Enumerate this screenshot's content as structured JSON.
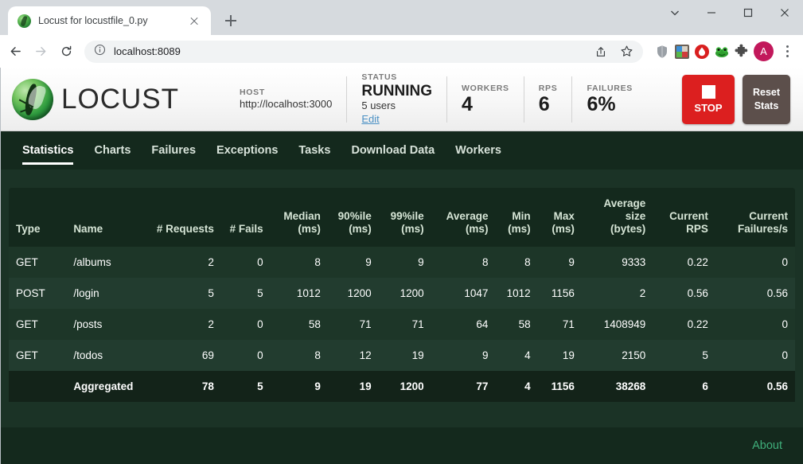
{
  "browser": {
    "tab": {
      "title": "Locust for locustfile_0.py",
      "favicon": "locust-icon",
      "close": "close-icon"
    },
    "new_tab": "new-tab-icon",
    "window_controls": [
      "tab-search-chevron-down",
      "minimize",
      "maximize",
      "close"
    ],
    "nav": {
      "back": "back-arrow-icon",
      "forward": "forward-arrow-icon",
      "reload": "reload-icon"
    },
    "omnibox": {
      "info_icon": "site-info-icon",
      "url": "localhost:8089",
      "share": "share-icon",
      "bookmark": "star-icon"
    },
    "extensions": [
      "shield-icon",
      "colorful-extension-icon",
      "adblock-icon",
      "frog-extension-icon",
      "puzzle-piece-icon"
    ],
    "avatar_letter": "A",
    "menu": "kebab-menu-icon"
  },
  "app": {
    "brand": "LOCUST",
    "stats": [
      {
        "label": "HOST",
        "value": "http://localhost:3000",
        "type": "text"
      },
      {
        "label": "STATUS",
        "value": "RUNNING",
        "sub": "5 users",
        "link": "Edit",
        "type": "status"
      },
      {
        "label": "WORKERS",
        "value": "4",
        "type": "big"
      },
      {
        "label": "RPS",
        "value": "6",
        "type": "big"
      },
      {
        "label": "FAILURES",
        "value": "6%",
        "type": "big"
      }
    ],
    "buttons": {
      "stop": "STOP",
      "reset": "Reset\nStats",
      "reset_line1": "Reset",
      "reset_line2": "Stats"
    },
    "colors": {
      "stop": "#dc1f1f",
      "reset": "#5c4f4b",
      "nav_bg": "#14291d",
      "page_bg": "#1b3326",
      "link": "#3fae7a"
    },
    "nav_tabs": [
      {
        "label": "Statistics",
        "active": true
      },
      {
        "label": "Charts",
        "active": false
      },
      {
        "label": "Failures",
        "active": false
      },
      {
        "label": "Exceptions",
        "active": false
      },
      {
        "label": "Tasks",
        "active": false
      },
      {
        "label": "Download Data",
        "active": false
      },
      {
        "label": "Workers",
        "active": false
      }
    ],
    "footer": {
      "about": "About"
    }
  },
  "table": {
    "columns": [
      {
        "label": "Type",
        "align": "left"
      },
      {
        "label": "Name",
        "align": "left"
      },
      {
        "label": "# Requests",
        "align": "right"
      },
      {
        "label": "# Fails",
        "align": "right"
      },
      {
        "label": "Median\n(ms)",
        "align": "right",
        "line1": "Median",
        "line2": "(ms)"
      },
      {
        "label": "90%ile\n(ms)",
        "align": "right",
        "line1": "90%ile",
        "line2": "(ms)"
      },
      {
        "label": "99%ile\n(ms)",
        "align": "right",
        "line1": "99%ile",
        "line2": "(ms)"
      },
      {
        "label": "Average\n(ms)",
        "align": "right",
        "line1": "Average",
        "line2": "(ms)"
      },
      {
        "label": "Min\n(ms)",
        "align": "right",
        "line1": "Min",
        "line2": "(ms)"
      },
      {
        "label": "Max\n(ms)",
        "align": "right",
        "line1": "Max",
        "line2": "(ms)"
      },
      {
        "label": "Average size\n(bytes)",
        "align": "right",
        "line1": "Average",
        "line2": "size",
        "line3": "(bytes)"
      },
      {
        "label": "Current RPS",
        "align": "right",
        "line1": "Current",
        "line2": "RPS"
      },
      {
        "label": "Current Failures/s",
        "align": "right",
        "line1": "Current",
        "line2": "Failures/s"
      }
    ],
    "rows": [
      {
        "type": "GET",
        "name": "/albums",
        "requests": "2",
        "fails": "0",
        "median": "8",
        "p90": "9",
        "p99": "9",
        "average": "8",
        "min": "8",
        "max": "9",
        "avg_size": "9333",
        "current_rps": "0.22",
        "current_failures": "0"
      },
      {
        "type": "POST",
        "name": "/login",
        "requests": "5",
        "fails": "5",
        "median": "1012",
        "p90": "1200",
        "p99": "1200",
        "average": "1047",
        "min": "1012",
        "max": "1156",
        "avg_size": "2",
        "current_rps": "0.56",
        "current_failures": "0.56"
      },
      {
        "type": "GET",
        "name": "/posts",
        "requests": "2",
        "fails": "0",
        "median": "58",
        "p90": "71",
        "p99": "71",
        "average": "64",
        "min": "58",
        "max": "71",
        "avg_size": "1408949",
        "current_rps": "0.22",
        "current_failures": "0"
      },
      {
        "type": "GET",
        "name": "/todos",
        "requests": "69",
        "fails": "0",
        "median": "8",
        "p90": "12",
        "p99": "19",
        "average": "9",
        "min": "4",
        "max": "19",
        "avg_size": "2150",
        "current_rps": "5",
        "current_failures": "0"
      }
    ],
    "aggregated": {
      "type": "",
      "name": "Aggregated",
      "requests": "78",
      "fails": "5",
      "median": "9",
      "p90": "19",
      "p99": "1200",
      "average": "77",
      "min": "4",
      "max": "1156",
      "avg_size": "38268",
      "current_rps": "6",
      "current_failures": "0.56"
    }
  }
}
